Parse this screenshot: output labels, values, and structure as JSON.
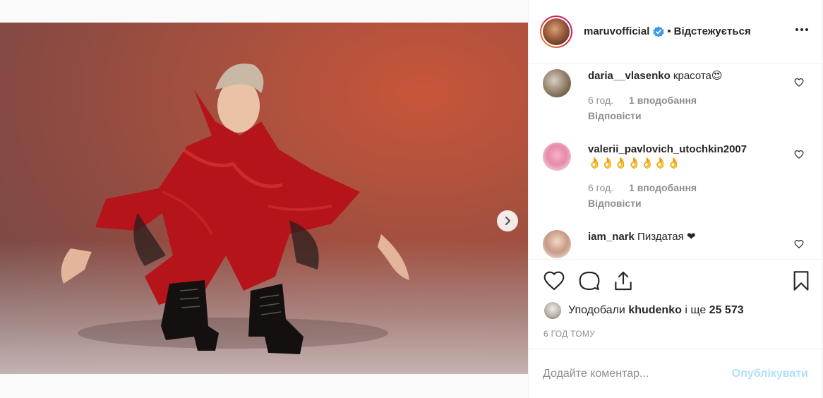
{
  "post": {
    "carousel": {
      "dot_count": 3,
      "active_index": 0
    }
  },
  "header": {
    "username": "maruvofficial",
    "separator": "•",
    "follow_status": "Відстежується"
  },
  "comments": [
    {
      "username": "daria__vlasenko",
      "text": "красота😍",
      "time": "6 год.",
      "likes": "1 вподобання",
      "reply": "Відповісти"
    },
    {
      "username": "valerii_pavlovich_utochkin2007",
      "text": "👌👌👌👌👌👌👌",
      "time": "6 год.",
      "likes": "1 вподобання",
      "reply": "Відповісти"
    },
    {
      "username": "iam_nark",
      "text": "Пиздатая ❤"
    }
  ],
  "likes": {
    "prefix": "Уподобали",
    "user": "khudenko",
    "connector": "і ще",
    "count": "25 573"
  },
  "timestamp": "6 ГОД ТОМУ",
  "add_comment": {
    "placeholder": "Додайте коментар...",
    "publish_label": "Опублікувати"
  },
  "colors": {
    "verified": "#3897f0",
    "publish_disabled": "#b2dffc",
    "meta_text": "#8e8e8e",
    "heart_red": "#ed4956"
  }
}
